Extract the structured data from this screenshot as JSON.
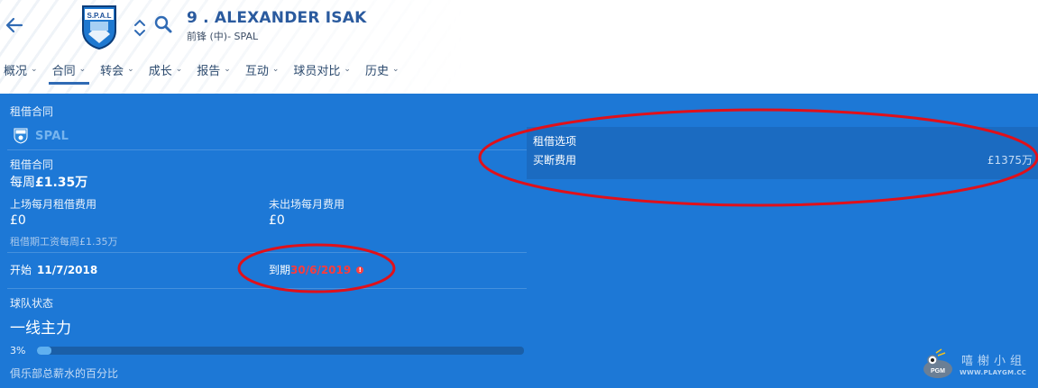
{
  "header": {
    "player_name": "9 . ALEXANDER ISAK",
    "player_sub": "前锋 (中)- SPAL",
    "crest_text": "S.P.A.L"
  },
  "nav": {
    "items": [
      {
        "label": "概况"
      },
      {
        "label": "合同"
      },
      {
        "label": "转会"
      },
      {
        "label": "成长"
      },
      {
        "label": "报告"
      },
      {
        "label": "互动"
      },
      {
        "label": "球员对比"
      },
      {
        "label": "历史"
      }
    ],
    "active_index": 1
  },
  "loan": {
    "section_title": "租借合同",
    "club_name": "SPAL",
    "contract_label": "租借合同",
    "weekly_prefix": "每周",
    "weekly_amount": "£1.35万",
    "monthly_played_label": "上场每月租借费用",
    "monthly_played_value": "£0",
    "monthly_unplayed_label": "未出场每月费用",
    "monthly_unplayed_value": "£0",
    "wage_note": "租借期工资每周£1.35万",
    "start_label": "开始",
    "start_date": "11/7/2018",
    "end_label": "到期",
    "end_date": "30/6/2019",
    "team_status_label": "球队状态",
    "team_status_value": "一线主力",
    "wage_percent_text": "3%",
    "wage_percent": 3,
    "wage_percent_caption": "俱乐部总薪水的百分比"
  },
  "loan_options": {
    "title": "租借选项",
    "buyout_label": "买断费用",
    "buyout_value": "£1375万"
  },
  "watermark": {
    "text": "嘻榭小组",
    "url": "WWW.PLAYGM.CC"
  },
  "colors": {
    "panel_blue": "#1d78d6",
    "annotation_red": "#e0101a",
    "end_date_red": "#ff3a3a"
  }
}
